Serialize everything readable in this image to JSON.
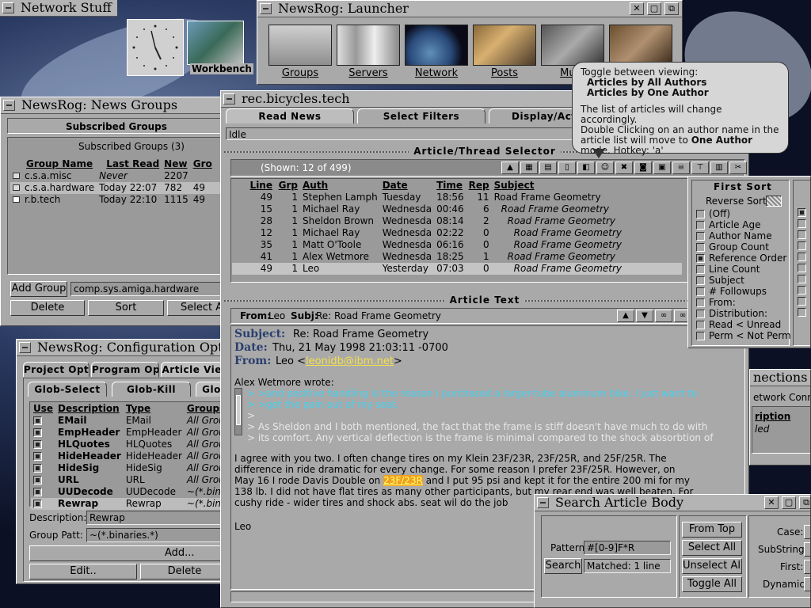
{
  "desktop": {
    "network_title": "Network Stuff",
    "workbench_label": "Workbench"
  },
  "launcher": {
    "title": "NewsRog: Launcher",
    "items": [
      "Groups",
      "Servers",
      "Network",
      "Posts",
      "Multi"
    ]
  },
  "tooltip": {
    "line1": "Toggle between viewing:",
    "line2": "Articles by All Authors",
    "line3": "Articles by One Author",
    "line4": "The list of articles will change accordingly.",
    "line5": "Double Clicking on an author name in the",
    "line6_pre": "article list will move to ",
    "line6_bold": "One Author",
    "line7": "mode.  Hotkey: 'a'"
  },
  "groups": {
    "title": "NewsRog: News Groups",
    "section": "Subscribed Groups",
    "list_title": "Subscribed Groups (3)",
    "headers": [
      "Group Name",
      "Last Read",
      "New",
      "Gro"
    ],
    "rows": [
      {
        "name": "c.s.a.misc",
        "last": "Never",
        "new": "2207",
        "gro": ""
      },
      {
        "name": "c.s.a.hardware",
        "last": "Today   22:07",
        "new": "782",
        "gro": "49"
      },
      {
        "name": "r.b.tech",
        "last": "Today   22:10",
        "new": "1115",
        "gro": "49"
      }
    ],
    "add_label": "Add Group",
    "add_value": "comp.sys.amiga.hardware",
    "delete": "Delete",
    "sort": "Sort",
    "select": "Select A"
  },
  "config": {
    "title": "NewsRog: Configuration Options",
    "tabs": [
      "Project Opt",
      "Program Op",
      "Article View"
    ],
    "subtabs": [
      "Glob-Select",
      "Glob-Kill",
      "Glo"
    ],
    "headers": [
      "Use",
      "Description",
      "Type",
      "Groups"
    ],
    "rows": [
      {
        "desc": "EMail",
        "type": "EMail",
        "grp": "All Grou"
      },
      {
        "desc": "EmpHeader",
        "type": "EmpHeader",
        "grp": "All Grou"
      },
      {
        "desc": "HLQuotes",
        "type": "HLQuotes",
        "grp": "All Grou"
      },
      {
        "desc": "HideHeader",
        "type": "HideHeader",
        "grp": "All Grou"
      },
      {
        "desc": "HideSig",
        "type": "HideSig",
        "grp": "All Grou"
      },
      {
        "desc": "URL",
        "type": "URL",
        "grp": "All Grou"
      },
      {
        "desc": "UUDecode",
        "type": "UUDecode",
        "grp": "~(*.binar"
      },
      {
        "desc": "Rewrap",
        "type": "Rewrap",
        "grp": "~(*.binar"
      }
    ],
    "desc_label": "Description:",
    "desc_value": "Rewrap",
    "patt_label": "Group Patt:",
    "patt_value": "~(*.binaries.*)",
    "add": "Add...",
    "edit": "Edit..",
    "delete": "Delete"
  },
  "main": {
    "title": "rec.bicycles.tech",
    "tabs": [
      "Read News",
      "Select Filters",
      "Display/Action"
    ],
    "status": "Idle",
    "selector_title": "Article/Thread Selector",
    "shown": "(Shown: 12 of 499)",
    "headers": [
      "Line",
      "Grp",
      "Auth",
      "Date",
      "Time",
      "Rep",
      "Subject"
    ],
    "rows": [
      {
        "line": "49",
        "grp": "1",
        "auth": "Stephen Lamph",
        "date": "Tuesday",
        "time": "18:56",
        "rep": "11",
        "subj": "Road Frame Geometry"
      },
      {
        "line": "15",
        "grp": "1",
        "auth": "Michael Ray",
        "date": "Wednesda",
        "time": "00:46",
        "rep": "6",
        "subj": "Road Frame Geometry"
      },
      {
        "line": "28",
        "grp": "1",
        "auth": "Sheldon Brown",
        "date": "Wednesda",
        "time": "08:14",
        "rep": "2",
        "subj": "Road Frame Geometry"
      },
      {
        "line": "12",
        "grp": "1",
        "auth": "Michael Ray",
        "date": "Wednesda",
        "time": "02:22",
        "rep": "0",
        "subj": "Road Frame Geometry"
      },
      {
        "line": "35",
        "grp": "1",
        "auth": "Matt O'Toole",
        "date": "Wednesda",
        "time": "06:16",
        "rep": "0",
        "subj": "Road Frame Geometry"
      },
      {
        "line": "41",
        "grp": "1",
        "auth": "Alex Wetmore",
        "date": "Wednesda",
        "time": "18:25",
        "rep": "1",
        "subj": "Road Frame Geometry"
      },
      {
        "line": "49",
        "grp": "1",
        "auth": "Leo",
        "date": "Yesterday",
        "time": "07:03",
        "rep": "0",
        "subj": "Road Frame Geometry"
      }
    ],
    "article_title": "Article Text",
    "from_label": "From:",
    "from_value": "Leo",
    "subj_label": "Subj:",
    "subj_value": "Re: Road Frame Geometry",
    "hdr_subject_label": "Subject:",
    "hdr_subject": "Re: Road Frame Geometry",
    "hdr_date_label": "Date:",
    "hdr_date": "Thu, 21 May 1998 21:03:11 -0700",
    "hdr_from_label": "From:",
    "hdr_from_name": "Leo <",
    "hdr_from_email": "leonidb@ibm.net",
    "hdr_from_close": ">",
    "wrote": "Alex Wetmore wrote:",
    "quote1": "> >and positive handling is the reason I purchased a larger-tube aluminum bike.  I just want to",
    "quote2": "> >get the pain out of my seat.",
    "quote3": ">",
    "quote4": "> As Sheldon and I both mentioned, the fact that the frame is stiff doesn't have much to do with",
    "quote5": "> its comfort.  Any vertical deflection is the frame is minimal compared to the shock absorbtion of",
    "body1": "I agree with you two. I often change tires on my Klein 23F/23R, 23F/25R, and 25F/25R. The",
    "body2": "difference in ride dramatic for every change. For some reason I prefer 23F/25R. However, on",
    "body3_pre": "May 16 I rode Davis Double on ",
    "body3_hl": "23F/23R",
    "body3_post": " and I put 95 psi and kept it for the entire 200 mi for my",
    "body4": "138 lb. I did not have flat tires as many other participants, but my rear end was well beaten. For",
    "body5": "cushy ride - wider tires and shock abs. seat wil do the job",
    "sig": "Leo"
  },
  "sort": {
    "title": "First Sort",
    "reverse": "Reverse Sort:",
    "options": [
      "(Off)",
      "Article Age",
      "Author Name",
      "Group Count",
      "Reference Order",
      "Line Count",
      "Subject",
      "# Followups",
      "From:",
      "Distribution:",
      "Read < Unread",
      "Perm < Not Perm"
    ],
    "selected_index": 4
  },
  "connections": {
    "title": "nections",
    "label": "etwork Conn",
    "col": "ription",
    "val": "led"
  },
  "search": {
    "title": "Search Article Body",
    "pattern_label": "Pattern:",
    "pattern_value": "#[0-9]F*R",
    "search_btn": "Search",
    "matched": "Matched:  1 line",
    "from_top": "From Top",
    "select_all": "Select All",
    "unselect_all": "Unselect All",
    "toggle_all": "Toggle All",
    "case": "Case:",
    "substring": "SubString:",
    "first": "First:",
    "dynamic": "Dynamic:"
  },
  "colors": {
    "window_gray": "#a9a9a9",
    "quote_cyan": "#46d2f0",
    "link_yellow": "#f4e04a",
    "highlight_orange": "#f0a020",
    "header_blue": "#2a3f6e"
  }
}
